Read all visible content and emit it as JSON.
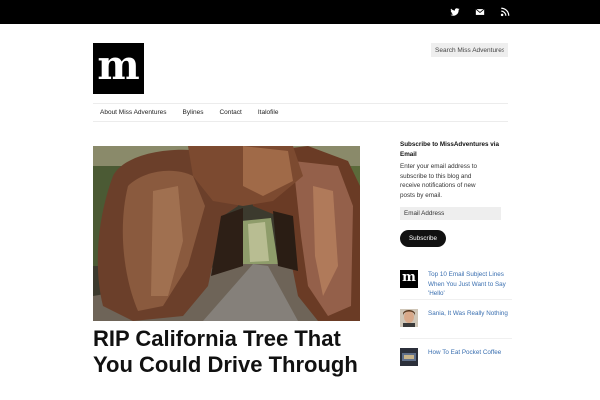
{
  "topbar": {
    "icons": [
      "twitter-icon",
      "email-icon",
      "rss-icon"
    ]
  },
  "header": {
    "logo_letter": "m",
    "search_placeholder": "Search Miss Adventures..."
  },
  "nav": {
    "items": [
      {
        "label": "About Miss Adventures"
      },
      {
        "label": "Bylines"
      },
      {
        "label": "Contact"
      },
      {
        "label": "Italofile"
      }
    ]
  },
  "article": {
    "title": "RIP California Tree That You Could Drive Through"
  },
  "sidebar": {
    "subscribe_title": "Subscribe to MissAdventures via Email",
    "subscribe_desc": "Enter your email address to subscribe to this blog and receive notifications of new posts by email.",
    "email_placeholder": "Email Address",
    "subscribe_label": "Subscribe",
    "posts": [
      {
        "title": "Top 10 Email Subject Lines When You Just Want to Say 'Hello'",
        "thumb_letter": "m"
      },
      {
        "title": "Sania, It Was Really Nothing"
      },
      {
        "title": "How To Eat Pocket Coffee"
      }
    ]
  },
  "colors": {
    "topbar": "#000000",
    "link": "#3a6fb0",
    "button": "#111111"
  }
}
